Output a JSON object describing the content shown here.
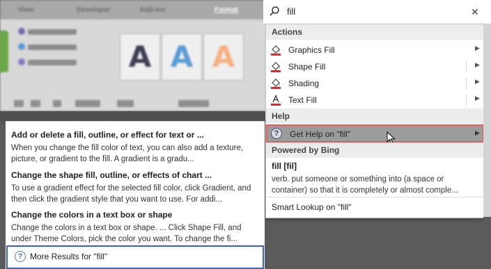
{
  "ribbon": {
    "tabs": [
      "View",
      "Developer",
      "Add-ins",
      "Format"
    ],
    "active_tab": "Format"
  },
  "search": {
    "value": "fill"
  },
  "dropdown": {
    "actions_header": "Actions",
    "actions": [
      {
        "label": "Graphics Fill",
        "icon": "paint-bucket-icon"
      },
      {
        "label": "Shape Fill",
        "icon": "paint-bucket-icon"
      },
      {
        "label": "Shading",
        "icon": "paint-bucket-icon"
      },
      {
        "label": "Text Fill",
        "icon": "text-color-icon"
      }
    ],
    "help_header": "Help",
    "get_help_label": "Get Help on \"fill\"",
    "bing_header": "Powered by Bing",
    "bing_word": "fill [fil]",
    "bing_definition": "verb. put someone or something into (a space or container) so that it is completely or almost comple...",
    "smart_lookup": "Smart Lookup on \"fill\""
  },
  "help_results": [
    {
      "title": "Add or delete a fill, outline, or effect for text or ...",
      "desc": "When you change the fill color of text, you can also add a texture, picture, or gradient to the fill. A gradient is a gradu..."
    },
    {
      "title": "Change the shape fill, outline, or effects of chart ...",
      "desc": "To use a gradient effect for the selected fill color, click Gradient, and then click the gradient style that you want to use. For addi..."
    },
    {
      "title": "Change the colors in a text box or shape",
      "desc": "Change the colors in a text box or shape. ... Click Shape Fill, and under Theme Colors, pick the color you want. To change the fi..."
    }
  ],
  "more_results": "More Results for \"fill\"",
  "colors": {
    "highlight_red": "#e25c5c",
    "highlight_blue": "#3a5ec9",
    "wordart_blue": "#5b9bd5",
    "wordart_orange": "#f4b183"
  }
}
